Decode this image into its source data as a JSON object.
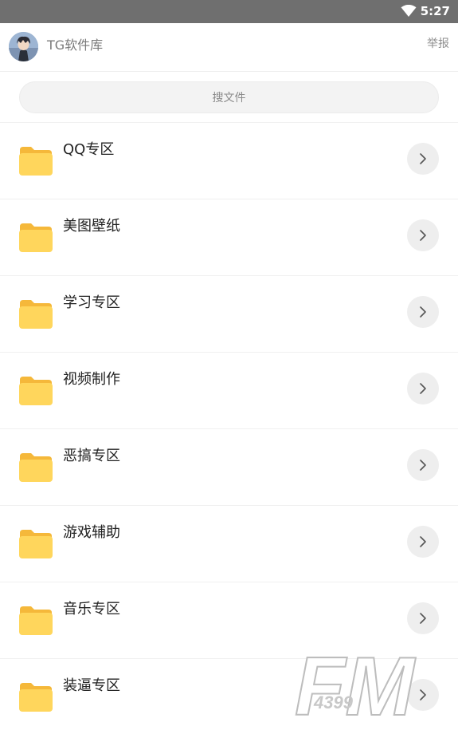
{
  "status_bar": {
    "time": "5:27"
  },
  "header": {
    "title": "TG软件库",
    "report_label": "举报"
  },
  "search": {
    "placeholder": "搜文件"
  },
  "folders": [
    {
      "label": "QQ专区"
    },
    {
      "label": "美图壁纸"
    },
    {
      "label": "学习专区"
    },
    {
      "label": "视频制作"
    },
    {
      "label": "恶搞专区"
    },
    {
      "label": "游戏辅助"
    },
    {
      "label": "音乐专区"
    },
    {
      "label": "装逼专区"
    }
  ],
  "watermark": {
    "brand": "FM",
    "code": "4399"
  },
  "colors": {
    "folder_front": "#FFD65C",
    "folder_back": "#F5B83A",
    "status_bar": "#6F6F6F",
    "arrow_bg": "#EEEEEE"
  }
}
